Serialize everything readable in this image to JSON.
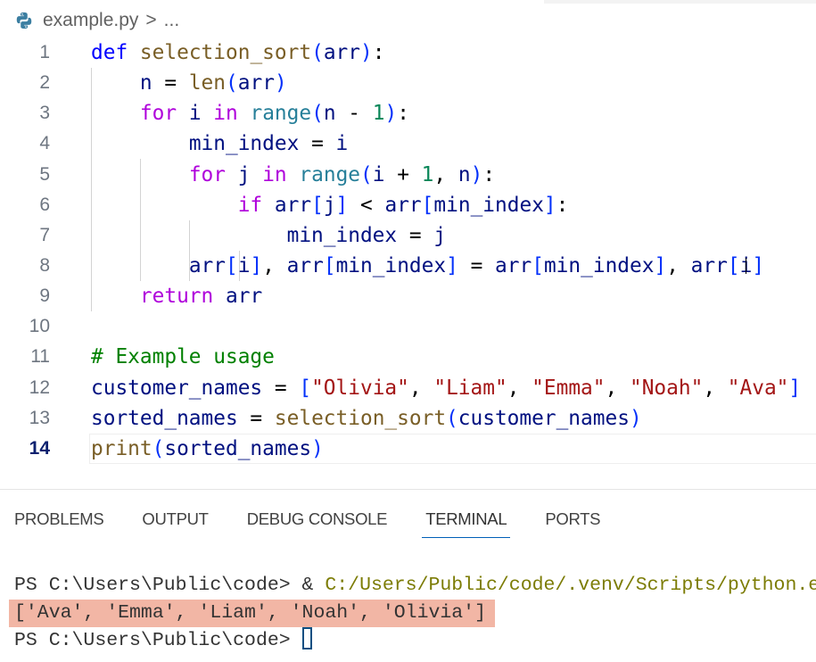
{
  "breadcrumb": {
    "file": "example.py",
    "separator": ">",
    "more": "..."
  },
  "editor": {
    "active_line": 14,
    "lines": [
      {
        "n": "1",
        "tokens": [
          [
            "def",
            "kw"
          ],
          [
            " ",
            "op"
          ],
          [
            "selection_sort",
            "fn"
          ],
          [
            "(",
            "br"
          ],
          [
            "arr",
            "var"
          ],
          [
            ")",
            "br"
          ],
          [
            ":",
            "op"
          ]
        ]
      },
      {
        "n": "2",
        "tokens": [
          [
            "    ",
            "op"
          ],
          [
            "n",
            "var"
          ],
          [
            " = ",
            "op"
          ],
          [
            "len",
            "fn"
          ],
          [
            "(",
            "br"
          ],
          [
            "arr",
            "var"
          ],
          [
            ")",
            "br"
          ]
        ]
      },
      {
        "n": "3",
        "tokens": [
          [
            "    ",
            "op"
          ],
          [
            "for",
            "ctl"
          ],
          [
            " ",
            "op"
          ],
          [
            "i",
            "var"
          ],
          [
            " ",
            "op"
          ],
          [
            "in",
            "ctl"
          ],
          [
            " ",
            "op"
          ],
          [
            "range",
            "cls"
          ],
          [
            "(",
            "br"
          ],
          [
            "n",
            "var"
          ],
          [
            " - ",
            "op"
          ],
          [
            "1",
            "num"
          ],
          [
            ")",
            "br"
          ],
          [
            ":",
            "op"
          ]
        ]
      },
      {
        "n": "4",
        "tokens": [
          [
            "        ",
            "op"
          ],
          [
            "min_index",
            "var"
          ],
          [
            " = ",
            "op"
          ],
          [
            "i",
            "var"
          ]
        ]
      },
      {
        "n": "5",
        "tokens": [
          [
            "        ",
            "op"
          ],
          [
            "for",
            "ctl"
          ],
          [
            " ",
            "op"
          ],
          [
            "j",
            "var"
          ],
          [
            " ",
            "op"
          ],
          [
            "in",
            "ctl"
          ],
          [
            " ",
            "op"
          ],
          [
            "range",
            "cls"
          ],
          [
            "(",
            "br"
          ],
          [
            "i",
            "var"
          ],
          [
            " + ",
            "op"
          ],
          [
            "1",
            "num"
          ],
          [
            ", ",
            "op"
          ],
          [
            "n",
            "var"
          ],
          [
            ")",
            "br"
          ],
          [
            ":",
            "op"
          ]
        ]
      },
      {
        "n": "6",
        "tokens": [
          [
            "            ",
            "op"
          ],
          [
            "if",
            "ctl"
          ],
          [
            " ",
            "op"
          ],
          [
            "arr",
            "var"
          ],
          [
            "[",
            "br"
          ],
          [
            "j",
            "var"
          ],
          [
            "]",
            "br"
          ],
          [
            " < ",
            "op"
          ],
          [
            "arr",
            "var"
          ],
          [
            "[",
            "br"
          ],
          [
            "min_index",
            "var"
          ],
          [
            "]",
            "br"
          ],
          [
            ":",
            "op"
          ]
        ]
      },
      {
        "n": "7",
        "tokens": [
          [
            "                ",
            "op"
          ],
          [
            "min_index",
            "var"
          ],
          [
            " = ",
            "op"
          ],
          [
            "j",
            "var"
          ]
        ]
      },
      {
        "n": "8",
        "tokens": [
          [
            "        ",
            "op"
          ],
          [
            "arr",
            "var"
          ],
          [
            "[",
            "br"
          ],
          [
            "i",
            "var"
          ],
          [
            "]",
            "br"
          ],
          [
            ", ",
            "op"
          ],
          [
            "arr",
            "var"
          ],
          [
            "[",
            "br"
          ],
          [
            "min_index",
            "var"
          ],
          [
            "]",
            "br"
          ],
          [
            " = ",
            "op"
          ],
          [
            "arr",
            "var"
          ],
          [
            "[",
            "br"
          ],
          [
            "min_index",
            "var"
          ],
          [
            "]",
            "br"
          ],
          [
            ", ",
            "op"
          ],
          [
            "arr",
            "var"
          ],
          [
            "[",
            "br"
          ],
          [
            "i",
            "var"
          ],
          [
            "]",
            "br"
          ]
        ]
      },
      {
        "n": "9",
        "tokens": [
          [
            "    ",
            "op"
          ],
          [
            "return",
            "ctl"
          ],
          [
            " ",
            "op"
          ],
          [
            "arr",
            "var"
          ]
        ]
      },
      {
        "n": "10",
        "tokens": []
      },
      {
        "n": "11",
        "tokens": [
          [
            "# Example usage",
            "cmt"
          ]
        ]
      },
      {
        "n": "12",
        "tokens": [
          [
            "customer_names",
            "var"
          ],
          [
            " = ",
            "op"
          ],
          [
            "[",
            "br"
          ],
          [
            "\"Olivia\"",
            "str"
          ],
          [
            ", ",
            "op"
          ],
          [
            "\"Liam\"",
            "str"
          ],
          [
            ", ",
            "op"
          ],
          [
            "\"Emma\"",
            "str"
          ],
          [
            ", ",
            "op"
          ],
          [
            "\"Noah\"",
            "str"
          ],
          [
            ", ",
            "op"
          ],
          [
            "\"Ava\"",
            "str"
          ],
          [
            "]",
            "br"
          ]
        ]
      },
      {
        "n": "13",
        "tokens": [
          [
            "sorted_names",
            "var"
          ],
          [
            " = ",
            "op"
          ],
          [
            "selection_sort",
            "fn"
          ],
          [
            "(",
            "br"
          ],
          [
            "customer_names",
            "var"
          ],
          [
            ")",
            "br"
          ]
        ]
      },
      {
        "n": "14",
        "tokens": [
          [
            "print",
            "fn"
          ],
          [
            "(",
            "br"
          ],
          [
            "sorted_names",
            "var"
          ],
          [
            ")",
            "br"
          ]
        ]
      }
    ]
  },
  "panel": {
    "tabs": [
      {
        "label": "PROBLEMS"
      },
      {
        "label": "OUTPUT"
      },
      {
        "label": "DEBUG CONSOLE"
      },
      {
        "label": "TERMINAL",
        "active": true
      },
      {
        "label": "PORTS"
      }
    ],
    "terminal": {
      "line1_prompt": "PS C:\\Users\\Public\\code> & ",
      "line1_path": "C:/Users/Public/code/.venv/Scripts/python.exe",
      "output": "['Ava', 'Emma', 'Liam', 'Noah', 'Olivia']",
      "line3_prompt": "PS C:\\Users\\Public\\code> "
    },
    "highlight_color": "#f2b6a5"
  }
}
